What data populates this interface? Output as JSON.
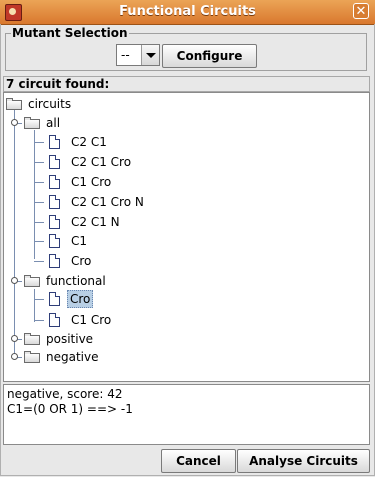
{
  "window": {
    "title": "Functional Circuits",
    "close_label": "✕"
  },
  "mutant": {
    "group_label": "Mutant Selection",
    "selected": "--",
    "configure_label": "Configure"
  },
  "status": {
    "found_text": "7 circuit found:"
  },
  "tree": {
    "root": "circuits",
    "all": {
      "label": "all",
      "items": [
        "C2 C1",
        "C2 C1 Cro",
        "C1 Cro",
        "C2 C1 Cro N",
        "C2 C1 N",
        "C1",
        "Cro"
      ]
    },
    "functional": {
      "label": "functional",
      "items": [
        "Cro",
        "C1 Cro"
      ],
      "selected": "Cro"
    },
    "positive": "positive",
    "negative": "negative"
  },
  "details": {
    "line1": "negative, score: 42",
    "line2": "C1=(0 OR 1) ==> -1"
  },
  "buttons": {
    "cancel": "Cancel",
    "analyse": "Analyse Circuits"
  },
  "colors": {
    "titlebar": "#e08a3c",
    "selection": "#b8cfe5"
  }
}
